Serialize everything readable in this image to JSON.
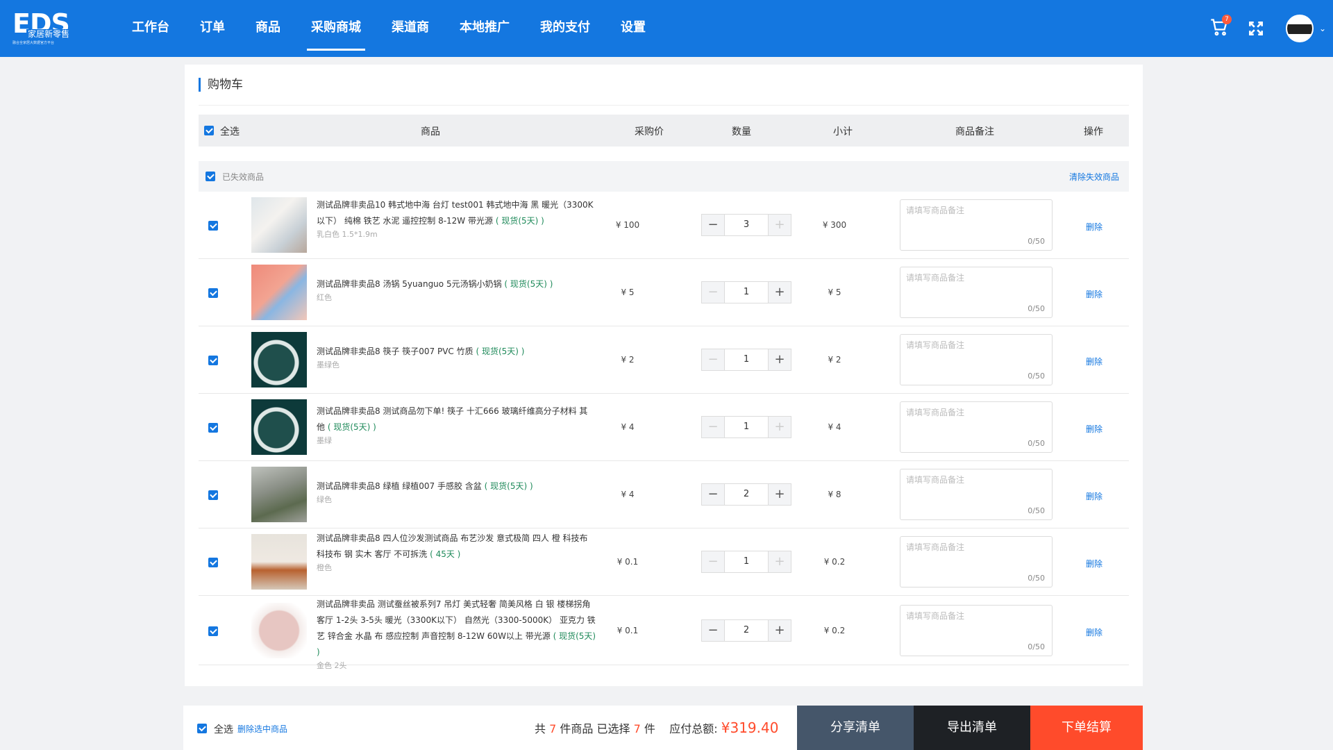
{
  "brand": {
    "logo_text": "EDS",
    "logo_sub": "家居新零售",
    "logo_tiny": "融合全家居大数据官方平台"
  },
  "nav": [
    {
      "label": "工作台"
    },
    {
      "label": "订单"
    },
    {
      "label": "商品"
    },
    {
      "label": "采购商城",
      "active": true
    },
    {
      "label": "渠道商"
    },
    {
      "label": "本地推广"
    },
    {
      "label": "我的支付"
    },
    {
      "label": "设置"
    }
  ],
  "header": {
    "cart_count": "7",
    "icons": [
      "cart-icon",
      "fullscreen-icon",
      "avatar",
      "chevron-down-icon"
    ]
  },
  "page": {
    "title": "购物车"
  },
  "table": {
    "select_all": "全选",
    "columns": [
      "商品",
      "采购价",
      "数量",
      "小计",
      "商品备注",
      "操作"
    ]
  },
  "invalid": {
    "label": "已失效商品",
    "clear": "清除失效商品"
  },
  "remark": {
    "placeholder": "请填写商品备注",
    "count": "0/50"
  },
  "delete_label": "删除",
  "items": [
    {
      "name": "测试品牌非卖品10 韩式地中海 台灯 test001 韩式地中海 黑 暖光（3300K以下） 纯棉 铁艺 水泥 遥控控制 8-12W 带光源",
      "stock": "( 现货(5天) )",
      "spec": "乳白色 1.5*1.9m",
      "price": "¥ 100",
      "qty": "3",
      "subtotal": "¥ 300"
    },
    {
      "name": "测试品牌非卖品8 汤锅 5yuanguo 5元汤锅小奶锅",
      "stock": "( 现货(5天) )",
      "spec": "红色",
      "price": "¥ 5",
      "qty": "1",
      "subtotal": "¥ 5"
    },
    {
      "name": "测试品牌非卖品8 筷子 筷子007 PVC 竹质",
      "stock": "( 现货(5天) )",
      "spec": "墨绿色",
      "price": "¥ 2",
      "qty": "1",
      "subtotal": "¥ 2"
    },
    {
      "name": "测试品牌非卖品8 测试商品勿下单! 筷子 十汇666 玻璃纤维高分子材料 其他",
      "stock": "( 现货(5天) )",
      "spec": "墨绿",
      "price": "¥ 4",
      "qty": "1",
      "subtotal": "¥ 4"
    },
    {
      "name": "测试品牌非卖品8 绿植 绿植007 手感胶 含盆",
      "stock": "( 现货(5天) )",
      "spec": "绿色",
      "price": "¥ 4",
      "qty": "2",
      "subtotal": "¥ 8"
    },
    {
      "name": "测试品牌非卖品8 四人位沙发测试商品 布艺沙发 意式极简 四人 橙 科技布 科技布 钢 实木 客厅 不可拆洗",
      "stock": "( 45天 )",
      "spec": "橙色",
      "price": "¥ 0.1",
      "qty": "1",
      "subtotal": "¥ 0.2"
    },
    {
      "name": "测试品牌非卖品 测试蚕丝被系列7 吊灯 美式轻奢 简美风格 白 银 楼梯拐角 客厅 1-2头 3-5头 暖光（3300K以下） 自然光（3300-5000K） 亚克力 铁艺 锌合金 水晶 布 感应控制 声音控制 8-12W 60W以上 带光源",
      "stock": "( 现货(5天) )",
      "spec": "金色 2头",
      "price": "¥ 0.1",
      "qty": "2",
      "subtotal": "¥ 0.2"
    }
  ],
  "footer": {
    "select_all": "全选",
    "delete_selected": "删除选中商品",
    "total_prefix": "共",
    "total_count": "7",
    "total_unit": "件商品",
    "selected_prefix": "已选择",
    "selected_count": "7",
    "selected_unit": "件",
    "payable_label": "应付总额:",
    "payable": "¥319.40",
    "share": "分享清单",
    "export": "导出清单",
    "checkout": "下单结算"
  }
}
